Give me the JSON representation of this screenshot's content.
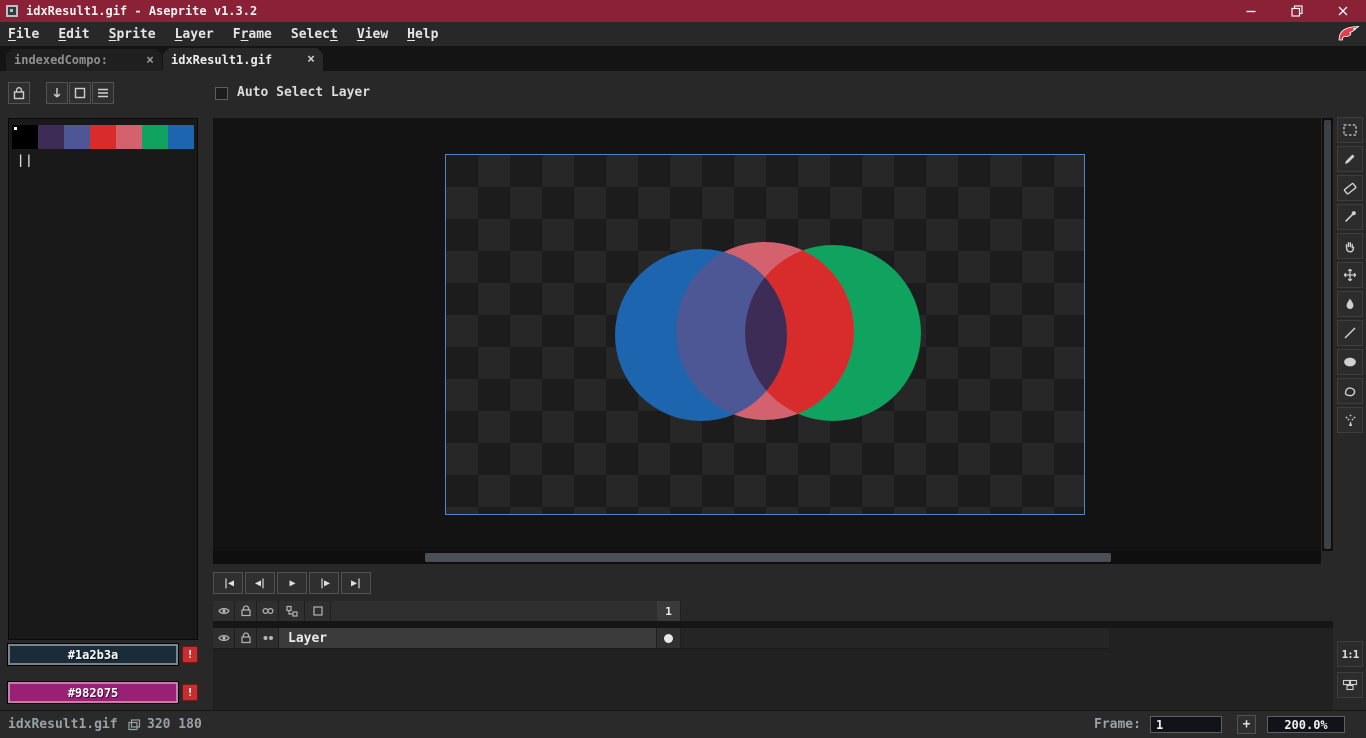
{
  "colors": {
    "titlebar": "#8a2136",
    "foreground": "#1a2b3a",
    "background": "#982075",
    "warning_glyph": "!",
    "checker_light": "#272727",
    "checker_dark": "#1c1c1c",
    "sprite_border": "#4c86c7"
  },
  "window": {
    "title": "idxResult1.gif - Aseprite v1.3.2"
  },
  "menubar": {
    "items": [
      {
        "pre": "",
        "key": "F",
        "post": "ile"
      },
      {
        "pre": "",
        "key": "E",
        "post": "dit"
      },
      {
        "pre": "",
        "key": "S",
        "post": "prite"
      },
      {
        "pre": "",
        "key": "L",
        "post": "ayer"
      },
      {
        "pre": "F",
        "key": "r",
        "post": "ame"
      },
      {
        "pre": "Selec",
        "key": "t",
        "post": ""
      },
      {
        "pre": "",
        "key": "V",
        "post": "iew"
      },
      {
        "pre": "",
        "key": "H",
        "post": "elp"
      }
    ]
  },
  "tabs": [
    {
      "label": "indexedCompo:",
      "close_glyph": "×",
      "active": false
    },
    {
      "label": "idxResult1.gif",
      "close_glyph": "×",
      "active": true
    }
  ],
  "context_bar": {
    "auto_select_layer_label": "Auto Select Layer",
    "auto_select_checked": false
  },
  "palette": {
    "selection_marker": "||",
    "swatches": [
      "#000000",
      "#3d2d56",
      "#4d5796",
      "#d82b2b",
      "#d4626e",
      "#10a25f",
      "#1d65af"
    ]
  },
  "artwork": {
    "green": "#10a25f",
    "red": "#d4626e",
    "red_green_overlap": "#d82b2b",
    "blue": "#1d65af",
    "blue_red_overlap": "#4d5796",
    "triple_overlap": "#3d2d56"
  },
  "playback": {
    "buttons": [
      "|◀",
      "◀|",
      "▶",
      "|▶",
      "▶|"
    ]
  },
  "timeline": {
    "frame_number": "1",
    "layer_name": "Layer"
  },
  "toolbar": {
    "tools": [
      "rectangular-marquee",
      "pencil",
      "eraser",
      "eyedropper",
      "hand",
      "move",
      "paint-bucket",
      "line",
      "ellipse",
      "contour",
      "spray"
    ],
    "one_to_one_label": "1:1"
  },
  "status_bar": {
    "filename": "idxResult1.gif",
    "canvas_size": "320 180",
    "frame_label": "Frame:",
    "frame_value": "1",
    "add_frame_glyph": "+",
    "zoom": "200.0%"
  }
}
